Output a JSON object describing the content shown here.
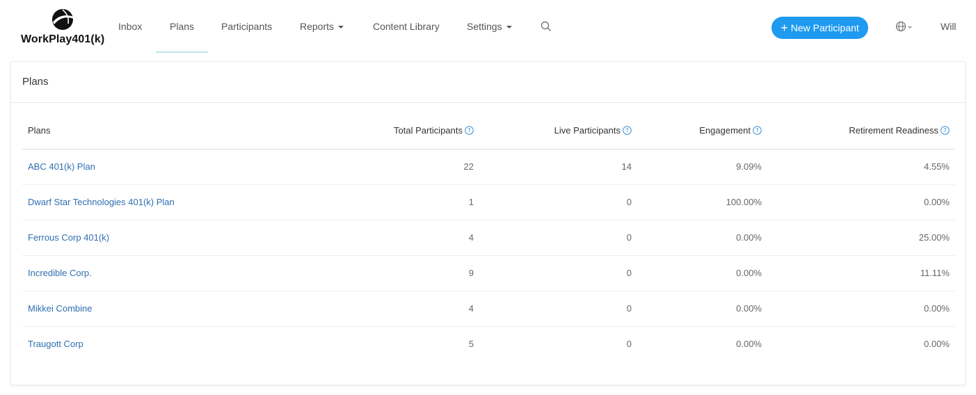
{
  "brand": {
    "name": "WorkPlay401(k)"
  },
  "nav": {
    "inbox": "Inbox",
    "plans": "Plans",
    "participants": "Participants",
    "reports": "Reports",
    "content_library": "Content Library",
    "settings": "Settings"
  },
  "actions": {
    "new_participant": "New Participant"
  },
  "user": {
    "name": "Will"
  },
  "icons": {
    "search": "search-icon",
    "globe": "globe-icon",
    "help": "help-circle-icon",
    "plus": "plus-icon"
  },
  "colors": {
    "accent": "#1e9af0",
    "link": "#2f6fb0",
    "active_underline": "#bfe3e6"
  },
  "panel": {
    "title": "Plans"
  },
  "table": {
    "headers": {
      "plans": "Plans",
      "total_participants": "Total Participants",
      "live_participants": "Live Participants",
      "engagement": "Engagement",
      "retirement_readiness": "Retirement Readiness"
    },
    "rows": [
      {
        "name": "ABC 401(k) Plan",
        "total": "22",
        "live": "14",
        "engagement": "9.09%",
        "readiness": "4.55%"
      },
      {
        "name": "Dwarf Star Technologies 401(k) Plan",
        "total": "1",
        "live": "0",
        "engagement": "100.00%",
        "readiness": "0.00%"
      },
      {
        "name": "Ferrous Corp 401(k)",
        "total": "4",
        "live": "0",
        "engagement": "0.00%",
        "readiness": "25.00%"
      },
      {
        "name": "Incredible Corp.",
        "total": "9",
        "live": "0",
        "engagement": "0.00%",
        "readiness": "11.11%"
      },
      {
        "name": "Mikkei Combine",
        "total": "4",
        "live": "0",
        "engagement": "0.00%",
        "readiness": "0.00%"
      },
      {
        "name": "Traugott Corp",
        "total": "5",
        "live": "0",
        "engagement": "0.00%",
        "readiness": "0.00%"
      }
    ]
  }
}
